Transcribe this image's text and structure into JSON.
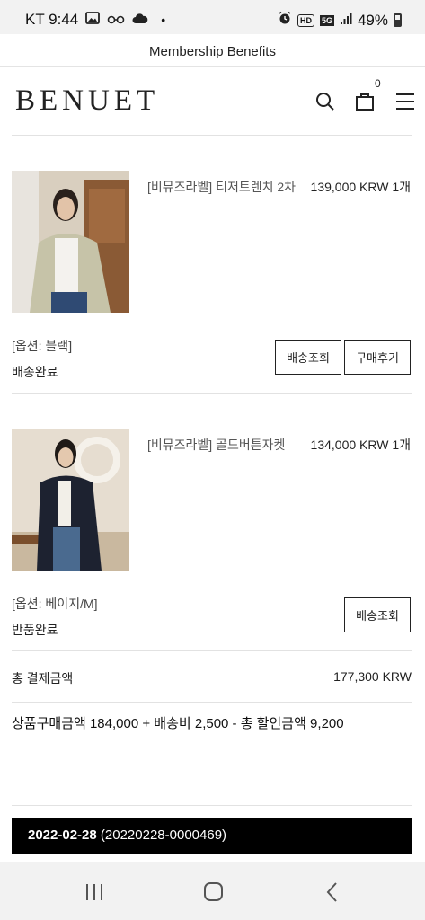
{
  "status_bar": {
    "carrier_time": "KT 9:44",
    "dot": "•",
    "hd_label": "HD",
    "fiveg_label": "5G",
    "battery": "49%"
  },
  "banner": {
    "text": "Membership Benefits"
  },
  "header": {
    "logo": "BENUET",
    "cart_count": "0"
  },
  "items": [
    {
      "name": "[비뮤즈라벨] 티저트렌치 2차",
      "price": "139,000 KRW 1개",
      "option": "[옵션: 블랙]",
      "status": "배송완료",
      "buttons": [
        "배송조회",
        "구매후기"
      ]
    },
    {
      "name": "[비뮤즈라벨] 골드버튼자켓",
      "price": "134,000 KRW 1개",
      "option": "[옵션: 베이지/M]",
      "status": "반품완료",
      "buttons": [
        "배송조회"
      ]
    }
  ],
  "totals": {
    "label": "총 결제금액",
    "value": "177,300 KRW",
    "breakdown": "상품구매금액 184,000 + 배송비 2,500 - 총 할인금액 9,200"
  },
  "next_order": {
    "date": "2022-02-28",
    "number": "(20220228-0000469)"
  },
  "colors": {
    "accent_bar": "#000000",
    "system_bar": "#f2f2f2"
  }
}
